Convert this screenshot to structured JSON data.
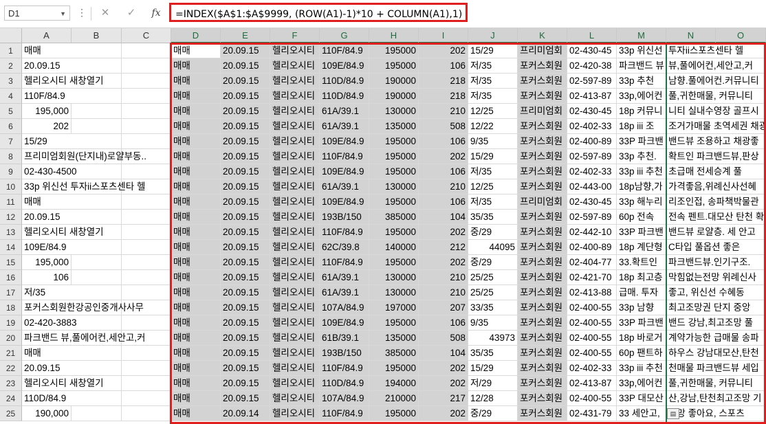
{
  "formula_bar": {
    "name_box": "D1",
    "formula": "=INDEX($A$1:$A$9999, (ROW(A1)-1)*10 + COLUMN(A1),1)",
    "cancel_icon": "✕",
    "enter_icon": "✓",
    "fx_label": "fx",
    "more_icon": "⋮"
  },
  "columns": [
    "A",
    "B",
    "C",
    "D",
    "E",
    "F",
    "G",
    "H",
    "I",
    "J",
    "K",
    "L",
    "M",
    "N",
    "O"
  ],
  "rows": [
    "1",
    "2",
    "3",
    "4",
    "5",
    "6",
    "7",
    "8",
    "9",
    "10",
    "11",
    "12",
    "13",
    "14",
    "15",
    "16",
    "17",
    "18",
    "19",
    "20",
    "21",
    "22",
    "23",
    "24",
    "25"
  ],
  "col_a": [
    {
      "v": "매매"
    },
    {
      "v": "20.09.15"
    },
    {
      "v": "헬리오시티 새창열기"
    },
    {
      "v": "110F/84.9"
    },
    {
      "v": "195,000",
      "num": true
    },
    {
      "v": "202",
      "num": true
    },
    {
      "v": "15/29"
    },
    {
      "v": "프리미엄회원(단지내)로얄부동.."
    },
    {
      "v": "02-430-4500"
    },
    {
      "v": "33p 위신선 투자ii스포츠센타 헬"
    },
    {
      "v": "매매"
    },
    {
      "v": "20.09.15"
    },
    {
      "v": "헬리오시티 새창열기"
    },
    {
      "v": "109E/84.9"
    },
    {
      "v": "195,000",
      "num": true
    },
    {
      "v": "106",
      "num": true
    },
    {
      "v": "저/35"
    },
    {
      "v": "포커스회원한강공인중개사사무"
    },
    {
      "v": "02-420-3883"
    },
    {
      "v": "파크밴드 뷰,풀에어컨,세안고,커"
    },
    {
      "v": "매매"
    },
    {
      "v": "20.09.15"
    },
    {
      "v": "헬리오시티 새창열기"
    },
    {
      "v": "110D/84.9"
    },
    {
      "v": "190,000",
      "num": true
    }
  ],
  "table": [
    [
      "매매",
      "20.09.15",
      "헬리오시티",
      "110F/84.9",
      "195000",
      "202",
      "15/29",
      "프리미엄회",
      "02-430-45",
      "33p 위신선",
      "투자ii스포츠센타 헬"
    ],
    [
      "매매",
      "20.09.15",
      "헬리오시티",
      "109E/84.9",
      "195000",
      "106",
      "저/35",
      "포커스회원",
      "02-420-38",
      "파크밴드 뷰",
      "뷰,풀에어컨,세안고,커"
    ],
    [
      "매매",
      "20.09.15",
      "헬리오시티",
      "110D/84.9",
      "190000",
      "218",
      "저/35",
      "포커스회원",
      "02-597-89",
      "33p 추천",
      "남향.풀에어컨.커뮤니티"
    ],
    [
      "매매",
      "20.09.15",
      "헬리오시티",
      "110D/84.9",
      "190000",
      "218",
      "저/35",
      "포커스회원",
      "02-413-87",
      "33p,에어컨",
      "풀,귀한매물, 커뮤니티"
    ],
    [
      "매매",
      "20.09.15",
      "헬리오시티",
      "61A/39.1",
      "130000",
      "210",
      "12/25",
      "프리미엄회",
      "02-430-45",
      "18p 커뮤니",
      "니티 실내수영장 골프시"
    ],
    [
      "매매",
      "20.09.15",
      "헬리오시티",
      "61A/39.1",
      "135000",
      "508",
      "12/22",
      "포커스회원",
      "02-402-33",
      "18p iii 조",
      "조거가매물 초역세권 채광"
    ],
    [
      "매매",
      "20.09.15",
      "헬리오시티",
      "109E/84.9",
      "195000",
      "106",
      "9/35",
      "포커스회원",
      "02-400-89",
      "33P 파크밴",
      "밴드뷰 조용하고 채광좋"
    ],
    [
      "매매",
      "20.09.15",
      "헬리오시티",
      "110F/84.9",
      "195000",
      "202",
      "15/29",
      "포커스회원",
      "02-597-89",
      "33p 추천.",
      "확트인 파크밴드뷰,판상"
    ],
    [
      "매매",
      "20.09.15",
      "헬리오시티",
      "109E/84.9",
      "195000",
      "106",
      "저/35",
      "포커스회원",
      "02-402-33",
      "33p iii 추천",
      "초급매 전세승계 풀"
    ],
    [
      "매매",
      "20.09.15",
      "헬리오시티",
      "61A/39.1",
      "130000",
      "210",
      "12/25",
      "포커스회원",
      "02-443-00",
      "18p남향,가",
      "가격좋음,위례신사선혜"
    ],
    [
      "매매",
      "20.09.15",
      "헬리오시티",
      "109E/84.9",
      "195000",
      "106",
      "저/35",
      "프리미엄회",
      "02-430-45",
      "33p 해누리",
      "리조인접, 송파책박물관"
    ],
    [
      "매매",
      "20.09.15",
      "헬리오시티",
      "193B/150",
      "385000",
      "104",
      "35/35",
      "포커스회원",
      "02-597-89",
      "60p 전속",
      "전속 펜트.대모산 탄천 확트"
    ],
    [
      "매매",
      "20.09.15",
      "헬리오시티",
      "110F/84.9",
      "195000",
      "202",
      "중/29",
      "포커스회원",
      "02-442-10",
      "33P 파크밴",
      "밴드뷰 로얄층. 세 안고"
    ],
    [
      "매매",
      "20.09.15",
      "헬리오시티",
      "62C/39.8",
      "140000",
      "212",
      "44095",
      "포커스회원",
      "02-400-89",
      "18p 계단형",
      "C타입 풀옵션 좋은"
    ],
    [
      "매매",
      "20.09.15",
      "헬리오시티",
      "110F/84.9",
      "195000",
      "202",
      "중/29",
      "포커스회원",
      "02-404-77",
      "33.확트인",
      "파크밴드뷰.인기구조."
    ],
    [
      "매매",
      "20.09.15",
      "헬리오시티",
      "61A/39.1",
      "130000",
      "210",
      "25/25",
      "포커스회원",
      "02-421-70",
      "18p 최고층",
      "막힘없는전망 위례신사"
    ],
    [
      "매매",
      "20.09.15",
      "헬리오시티",
      "61A/39.1",
      "130000",
      "210",
      "25/25",
      "포커스회원",
      "02-413-88",
      "급매. 투자",
      "좋고, 위신선 수혜동"
    ],
    [
      "매매",
      "20.09.15",
      "헬리오시티",
      "107A/84.9",
      "197000",
      "207",
      "33/35",
      "포커스회원",
      "02-400-55",
      "33p 남향",
      "최고조망권 단지 중앙"
    ],
    [
      "매매",
      "20.09.15",
      "헬리오시티",
      "109E/84.9",
      "195000",
      "106",
      "9/35",
      "포커스회원",
      "02-400-55",
      "33P 파크밴",
      "밴드 강남,최고조망 풀"
    ],
    [
      "매매",
      "20.09.15",
      "헬리오시티",
      "61B/39.1",
      "135000",
      "508",
      "43973",
      "포커스회원",
      "02-400-55",
      "18p 바로거",
      "계약가능한 급매물 송파"
    ],
    [
      "매매",
      "20.09.15",
      "헬리오시티",
      "193B/150",
      "385000",
      "104",
      "35/35",
      "포커스회원",
      "02-400-55",
      "60p 팬트하",
      "하우스 강남대모산,탄천"
    ],
    [
      "매매",
      "20.09.15",
      "헬리오시티",
      "110F/84.9",
      "195000",
      "202",
      "15/29",
      "포커스회원",
      "02-402-33",
      "33p iii 추천",
      "천매물 파크밴드뷰 세입"
    ],
    [
      "매매",
      "20.09.15",
      "헬리오시티",
      "110D/84.9",
      "194000",
      "202",
      "저/29",
      "포커스회원",
      "02-413-87",
      "33p,에어컨",
      "풀,귀한매물, 커뮤니티"
    ],
    [
      "매매",
      "20.09.15",
      "헬리오시티",
      "107A/84.9",
      "210000",
      "217",
      "12/28",
      "포커스회원",
      "02-400-55",
      "33P 대모산",
      "산,강남,탄천최고조망 기"
    ],
    [
      "매매",
      "20.09.14",
      "헬리오시티",
      "110F/84.9",
      "195000",
      "202",
      "중/29",
      "포커스회원",
      "02-431-79",
      "33 세안고,",
      "전망 좋아요, 스포츠"
    ]
  ],
  "paste_options_icon": "paste-options-icon"
}
